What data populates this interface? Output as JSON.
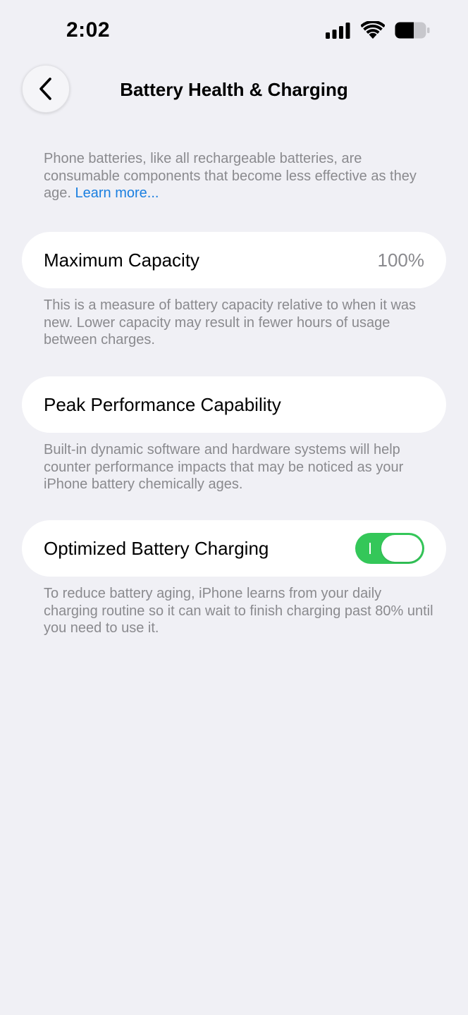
{
  "status_bar": {
    "time": "2:02",
    "icons": [
      "cellular-signal-icon",
      "wifi-icon",
      "battery-icon"
    ]
  },
  "header": {
    "back_icon": "chevron-left-icon",
    "title": "Battery Health & Charging"
  },
  "intro": {
    "text": "Phone batteries, like all rechargeable batteries, are consumable components that become less effective as they age. ",
    "link": "Learn more..."
  },
  "max_capacity": {
    "label": "Maximum Capacity",
    "value": "100%",
    "footnote": "This is a measure of battery capacity relative to when it was new. Lower capacity may result in fewer hours of usage between charges."
  },
  "peak_performance": {
    "label": "Peak Performance Capability",
    "footnote": "Built-in dynamic software and hardware systems will help counter performance impacts that may be noticed as your iPhone battery chemically ages."
  },
  "optimized_charging": {
    "label": "Optimized Battery Charging",
    "enabled": true,
    "toggle_color": "#34c759",
    "footnote": "To reduce battery aging, iPhone learns from your daily charging routine so it can wait to finish charging past 80% until you need to use it."
  },
  "colors": {
    "background": "#f0f0f5",
    "link": "#1a7fe0",
    "secondary_text": "#8a8a8e"
  }
}
